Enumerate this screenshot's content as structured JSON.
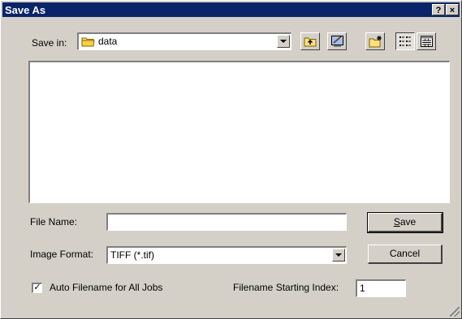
{
  "window": {
    "title": "Save As",
    "help_button": "?",
    "close_button": "×"
  },
  "toolbar": {
    "save_in_label": "Save in:",
    "location": "data",
    "location_icon": "folder-icon",
    "buttons": [
      {
        "name": "up-one-level-button",
        "icon": "up-folder-icon"
      },
      {
        "name": "desktop-button",
        "icon": "desktop-icon"
      },
      {
        "name": "new-folder-button",
        "icon": "new-folder-icon"
      },
      {
        "name": "list-view-button",
        "icon": "list-view-icon"
      },
      {
        "name": "details-view-button",
        "icon": "details-view-icon"
      }
    ]
  },
  "file_name": {
    "label": "File Name:",
    "value": ""
  },
  "image_format": {
    "label": "Image Format:",
    "value": "TIFF (*.tif)"
  },
  "buttons": {
    "save_prefix": "S",
    "save_rest": "ave",
    "cancel": "Cancel"
  },
  "auto_filename": {
    "label": "Auto Filename for All Jobs",
    "checked": true,
    "mark": "✓"
  },
  "starting_index": {
    "label": "Filename Starting Index:",
    "value": "1"
  }
}
